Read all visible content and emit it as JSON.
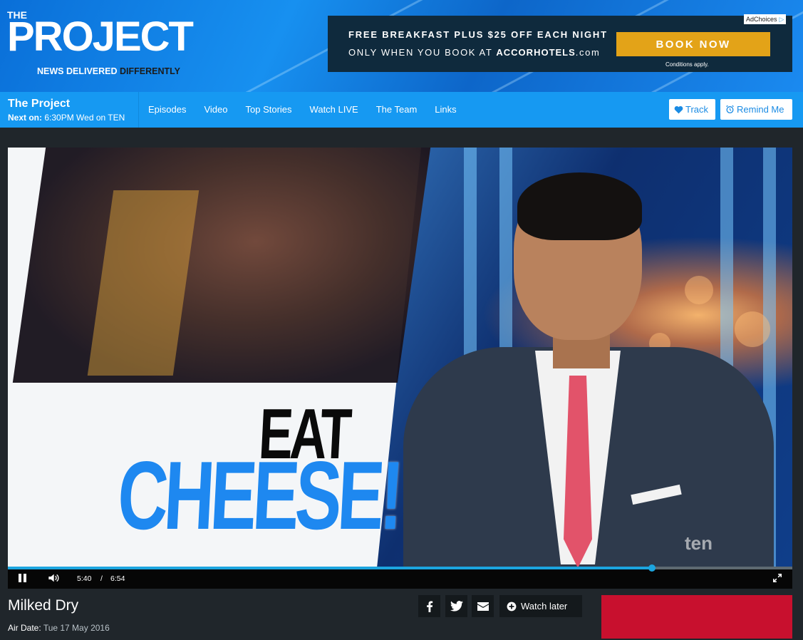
{
  "header": {
    "logo_the": "THE",
    "logo_project": "PROJECT",
    "tagline_prefix": "NEWS DELIVERED",
    "tagline_suffix": "DIFFERENTLY"
  },
  "ad": {
    "line1": "FREE BREAKFAST PLUS $25 OFF EACH NIGHT",
    "line2_prefix": "ONLY WHEN YOU BOOK AT",
    "brand": "ACCOR",
    "brand_suffix": "HOTELS",
    "brand_tld": ".com",
    "cta": "BOOK NOW",
    "conditions": "Conditions apply.",
    "adchoices": "AdChoices",
    "accent_color": "#e3a318"
  },
  "nav": {
    "show_title": "The Project",
    "next_label": "Next on:",
    "next_value": "6:30PM Wed on TEN",
    "links": [
      "Episodes",
      "Video",
      "Top Stories",
      "Watch LIVE",
      "The Team",
      "Links"
    ],
    "track_label": "Track",
    "remind_label": "Remind Me",
    "bar_color": "#1699f2"
  },
  "video": {
    "overlay_line1": "EAT",
    "overlay_line2": "CHEESE!",
    "watermark": "ten",
    "current_time": "5:40",
    "separator": "/",
    "duration": "6:54",
    "progress_fraction": 0.8213
  },
  "episode": {
    "title": "Milked Dry",
    "air_date_label": "Air Date:",
    "air_date_value": "Tue 17 May 2016",
    "watch_later_label": "Watch later",
    "share_icons": [
      "facebook-icon",
      "twitter-icon",
      "email-icon"
    ]
  }
}
